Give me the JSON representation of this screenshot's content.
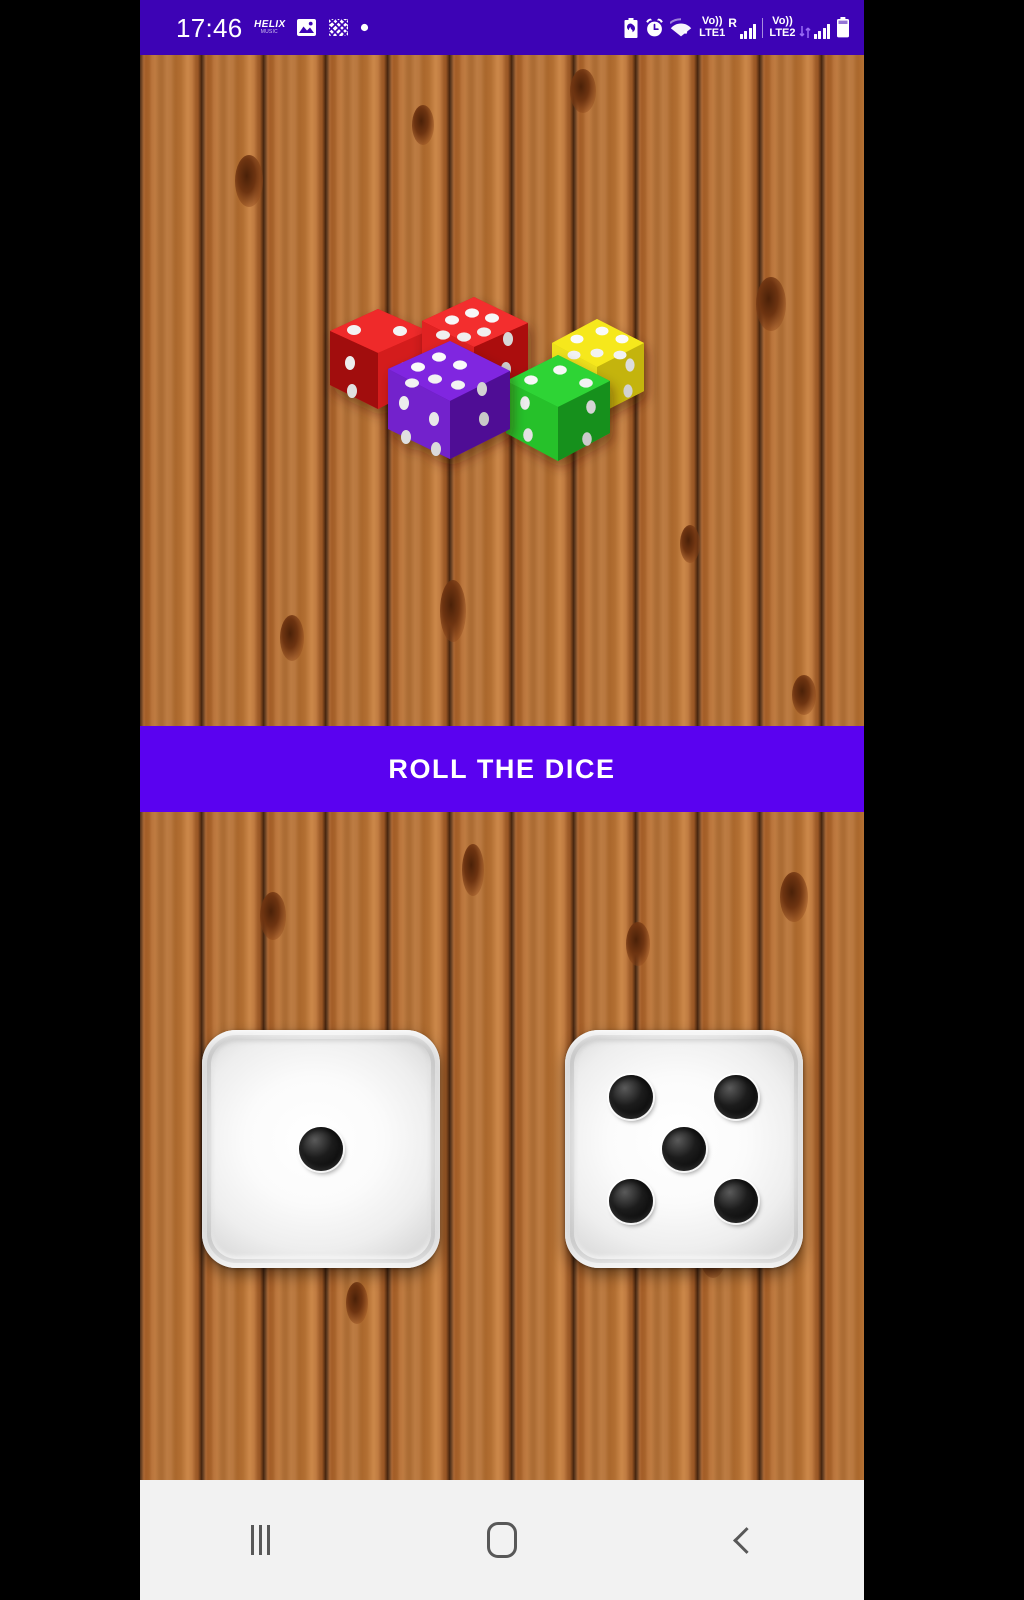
{
  "status_bar": {
    "clock": "17:46",
    "background_color": "#3d03b5",
    "notifications": [
      {
        "name": "helix-app-icon",
        "line1": "HELIX",
        "line2": "MUSIC"
      },
      {
        "name": "gallery-image-icon"
      },
      {
        "name": "crosshatch-app-icon"
      },
      {
        "name": "dot-notification-icon"
      }
    ],
    "system": {
      "battery_saver": "battery-saver-icon",
      "alarm": "alarm-icon",
      "wifi": "wifi-icon",
      "sim1": {
        "volte": "Vo))",
        "network": "LTE1",
        "roaming": "R"
      },
      "sim2": {
        "volte": "Vo))",
        "network": "LTE2"
      },
      "battery": "battery-icon"
    }
  },
  "app": {
    "background": "wood-plank-texture",
    "hero": {
      "name": "colored-dice-illustration",
      "dice": [
        {
          "color": "#d11a1a",
          "label": "red-die-back"
        },
        {
          "color": "#d81f1f",
          "label": "red-die-front"
        },
        {
          "color": "#6d17c9",
          "label": "purple-die"
        },
        {
          "color": "#e8d915",
          "label": "yellow-die"
        },
        {
          "color": "#23b52a",
          "label": "green-die"
        }
      ]
    },
    "roll_button": {
      "label": "ROLL THE DICE",
      "background_color": "#5a02f0",
      "text_color": "#ffffff"
    },
    "results": {
      "left_die": {
        "name": "die-left",
        "value": 1
      },
      "right_die": {
        "name": "die-right",
        "value": 5
      }
    }
  },
  "nav_bar": {
    "background_color": "#f2f2f2",
    "buttons": [
      {
        "name": "recents-button",
        "glyph": "|||"
      },
      {
        "name": "home-button",
        "glyph": "home"
      },
      {
        "name": "back-button",
        "glyph": "<"
      }
    ]
  }
}
